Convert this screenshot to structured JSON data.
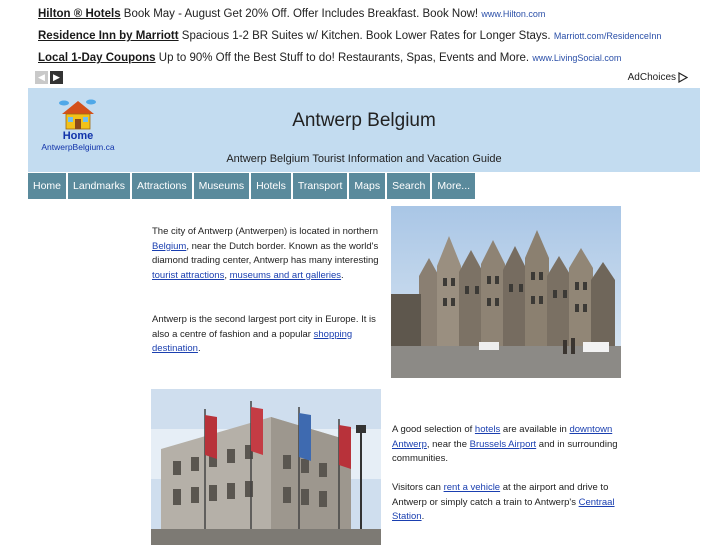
{
  "ads": [
    {
      "title": "Hilton ® Hotels",
      "text": "Book May - August Get 20% Off. Offer Includes Breakfast. Book Now!",
      "url": "www.Hilton.com"
    },
    {
      "title": "Residence Inn by Marriott",
      "text": "Spacious 1-2 BR Suites w/ Kitchen. Book Lower Rates for Longer Stays.",
      "url": "Marriott.com/ResidenceInn"
    },
    {
      "title": "Local 1-Day Coupons",
      "text": "Up to 90% Off the Best Stuff to do! Restaurants, Spas, Events and More.",
      "url": "www.LivingSocial.com"
    }
  ],
  "adchoices": "AdChoices",
  "header": {
    "logo_home": "Home",
    "logo_site": "AntwerpBelgium.ca",
    "title": "Antwerp Belgium",
    "subtitle": "Antwerp Belgium Tourist Information and Vacation Guide"
  },
  "nav": [
    "Home",
    "Landmarks",
    "Attractions",
    "Museums",
    "Hotels",
    "Transport",
    "Maps",
    "Search",
    "More..."
  ],
  "content": {
    "p1": {
      "t1": "The city of Antwerp (Antwerpen) is located in northern ",
      "l1": "Belgium",
      "t2": ", near the Dutch border.  Known as the world's diamond trading center, Antwerp has many interesting ",
      "l2": "tourist attractions",
      "t3": ", ",
      "l3": "museums and art galleries",
      "t4": "."
    },
    "p2": {
      "t1": "Antwerp is the second largest port city in Europe.  It is also a centre of fashion and a popular ",
      "l1": "shopping destination",
      "t2": "."
    },
    "p3": {
      "t1": "A good selection of ",
      "l1": "hotels",
      "t2": " are available in ",
      "l2": "downtown Antwerp",
      "t3": ", near the ",
      "l3": "Brussels Airport",
      "t4": " and in surrounding communities."
    },
    "p4": {
      "t1": "Visitors can ",
      "l1": "rent a vehicle",
      "t2": " at the airport and drive to Antwerp or simply catch a train to Antwerp's ",
      "l2": "Centraal Station",
      "t3": "."
    }
  },
  "colors": {
    "header_bg": "#c3dcf0",
    "nav_bg": "#5a8a9c",
    "link": "#1a3fb0"
  }
}
